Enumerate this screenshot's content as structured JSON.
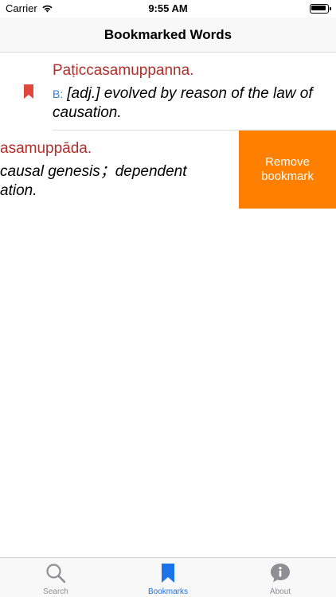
{
  "status_bar": {
    "carrier": "Carrier",
    "time": "9:55 AM"
  },
  "nav": {
    "title": "Bookmarked Words"
  },
  "entries": [
    {
      "word": "Paṭiccasamuppanna.",
      "source": "B:",
      "definition": "[adj.] evolved by reason of the law of causation."
    },
    {
      "word": "asamuppāda.",
      "definition_line1": "causal genesis；dependent",
      "definition_line2": "ation.",
      "action_label_line1": "Remove",
      "action_label_line2": "bookmark"
    }
  ],
  "tabs": [
    {
      "label": "Search",
      "icon": "search-icon"
    },
    {
      "label": "Bookmarks",
      "icon": "bookmark-icon"
    },
    {
      "label": "About",
      "icon": "info-bubble-icon"
    }
  ],
  "colors": {
    "accent": "#1a73e8",
    "word": "#b0302b",
    "source": "#2a7fd6",
    "bookmark_mark": "#e0473d",
    "swipe_action": "#ff7f00"
  }
}
